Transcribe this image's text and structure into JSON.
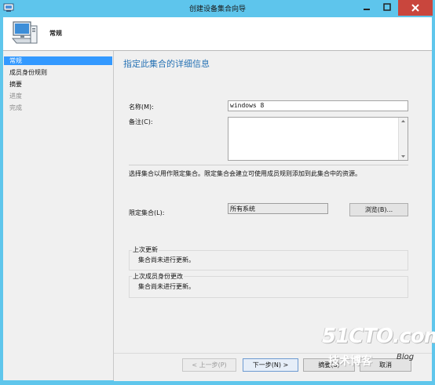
{
  "window": {
    "title": "创建设备集合向导"
  },
  "header": {
    "title": "常规"
  },
  "sidebar": {
    "items": [
      {
        "label": "常规",
        "state": "active"
      },
      {
        "label": "成员身份规则",
        "state": "normal"
      },
      {
        "label": "摘要",
        "state": "normal"
      },
      {
        "label": "进度",
        "state": "disabled"
      },
      {
        "label": "完成",
        "state": "disabled"
      }
    ]
  },
  "main": {
    "title": "指定此集合的详细信息",
    "name_label": "名称(M):",
    "name_value": "windows 8",
    "comment_label": "备注(C):",
    "comment_value": "",
    "description": "选择集合以用作限定集合。限定集合会建立可使用成员规则添加到此集合中的资源。",
    "limiting_label": "限定集合(L):",
    "limiting_value": "所有系统",
    "browse_label": "浏览(B)...",
    "last_update": {
      "legend": "上次更新",
      "text": "集合尚未进行更新。"
    },
    "last_membership_change": {
      "legend": "上次成员身份更改",
      "text": "集合尚未进行更新。"
    }
  },
  "footer": {
    "prev_label": "< 上一步(P)",
    "next_label": "下一步(N) >",
    "summary_label": "摘要(S)",
    "cancel_label": "取消"
  },
  "watermark": {
    "brand": "51CTO.com",
    "tagline": "技术博客",
    "blog": "Blog"
  },
  "colors": {
    "titlebar": "#5ec5ec",
    "accent": "#3399ff",
    "title_text": "#2873b5",
    "close_button": "#c9463d"
  }
}
